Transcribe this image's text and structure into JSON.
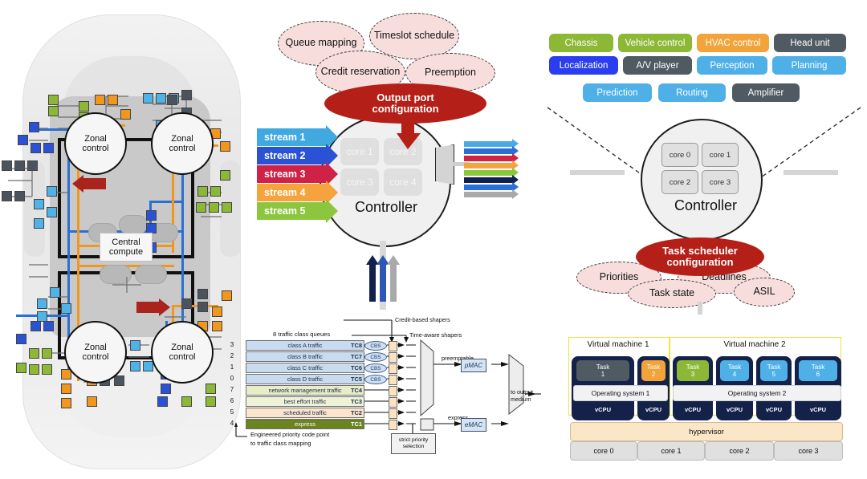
{
  "car_panel": {
    "zonal_controls": [
      {
        "id": "zonal-tl",
        "line1": "Zonal",
        "line2": "control"
      },
      {
        "id": "zonal-tr",
        "line1": "Zonal",
        "line2": "control"
      },
      {
        "id": "zonal-bl",
        "line1": "Zonal",
        "line2": "control"
      },
      {
        "id": "zonal-br",
        "line1": "Zonal",
        "line2": "control"
      }
    ],
    "central": {
      "line1": "Central",
      "line2": "compute"
    },
    "bus_colors": {
      "backbone": "#111111",
      "blue": "#2a6fd4",
      "orange": "#f0971f"
    },
    "ecu_colors": [
      "#7cb342",
      "#4a545e",
      "#f0971f",
      "#4fb3e8",
      "#2a52d4"
    ],
    "arrow_color": "#a8241c"
  },
  "mid_top": {
    "bubbles": [
      {
        "label": "Queue mapping"
      },
      {
        "label": "Timeslot schedule"
      },
      {
        "label": "Credit reservation"
      },
      {
        "label": "Preemption"
      }
    ],
    "config_ellipse": {
      "line1": "Output port",
      "line2": "configuration",
      "color": "#b41f18"
    },
    "streams": [
      {
        "label": "stream 1",
        "color": "#3fa9e0"
      },
      {
        "label": "stream 2",
        "color": "#2a52d4"
      },
      {
        "label": "stream 3",
        "color": "#cf2246"
      },
      {
        "label": "stream 4",
        "color": "#f5a33c"
      },
      {
        "label": "stream 5",
        "color": "#8cc63f"
      }
    ],
    "controller": {
      "label": "Controller",
      "cores": [
        "core 1",
        "core 2",
        "core 3",
        "core 4"
      ]
    },
    "output_arrow_colors": [
      "#4aabe3",
      "#2a6fd4",
      "#cf2246",
      "#f5a33c",
      "#8cc63f",
      "#11214b",
      "#2a6fd4",
      "#a9a9a9"
    ],
    "down_arrow_colors": [
      "#11214b",
      "#2f56b5",
      "#a9a9a9"
    ]
  },
  "right_top": {
    "chips_row1": [
      {
        "label": "Chassis",
        "color": "#8cb836"
      },
      {
        "label": "Vehicle control",
        "color": "#8cb836"
      },
      {
        "label": "HVAC control",
        "color": "#f2a33a"
      },
      {
        "label": "Head unit",
        "color": "#4f5a63"
      }
    ],
    "chips_row2": [
      {
        "label": "Localization",
        "color": "#2a3ef0"
      },
      {
        "label": "A/V player",
        "color": "#4f5a63"
      },
      {
        "label": "Perception",
        "color": "#4fb0e8"
      },
      {
        "label": "Planning",
        "color": "#4fb0e8"
      }
    ],
    "chips_row3": [
      {
        "label": "Prediction",
        "color": "#4fb0e8"
      },
      {
        "label": "Routing",
        "color": "#4fb0e8"
      },
      {
        "label": "Amplifier",
        "color": "#4f5a63"
      }
    ],
    "controller": {
      "label": "Controller",
      "cores": [
        "core 0",
        "core 1",
        "core 2",
        "core 3"
      ]
    },
    "config_ellipse": {
      "line1": "Task scheduler",
      "line2": "configuration",
      "color": "#b41f18"
    },
    "bubbles": [
      {
        "label": "Priorities"
      },
      {
        "label": "Deadlines"
      },
      {
        "label": "Task state"
      },
      {
        "label": "ASIL"
      }
    ]
  },
  "tsn": {
    "queues_title": "8 traffic class queues",
    "rows": [
      {
        "pcp": "3",
        "name": "class A traffic",
        "tc": "TC8",
        "fill": "#c9dcef",
        "text": "#21304a"
      },
      {
        "pcp": "2",
        "name": "class B traffic",
        "tc": "TC7",
        "fill": "#c9dcef",
        "text": "#21304a"
      },
      {
        "pcp": "1",
        "name": "class C traffic",
        "tc": "TC6",
        "fill": "#c9dcef",
        "text": "#21304a"
      },
      {
        "pcp": "0",
        "name": "class D traffic",
        "tc": "TC5",
        "fill": "#c9dcef",
        "text": "#21304a"
      },
      {
        "pcp": "7",
        "name": "network management traffic",
        "tc": "TC4",
        "fill": "#e7ecc9",
        "text": "#21304a"
      },
      {
        "pcp": "6",
        "name": "best effort traffic",
        "tc": "TC3",
        "fill": "#eef2d8",
        "text": "#21304a"
      },
      {
        "pcp": "5",
        "name": "scheduled traffic",
        "tc": "TC2",
        "fill": "#fbe6cd",
        "text": "#21304a"
      },
      {
        "pcp": "4",
        "name": "express",
        "tc": "TC1",
        "fill": "#6b8420",
        "text": "#ffffff"
      }
    ],
    "cbs_label": "CBS",
    "caption_mapping_l1": "Engineered priority code point",
    "caption_mapping_l2": "to traffic class mapping",
    "label_cbs_shapers": "Credit-based shapers",
    "label_tas_shapers": "Time-aware shapers",
    "label_strict_l1": "strict priority",
    "label_strict_l2": "selection",
    "label_preemptable": "preemptable",
    "label_express": "express",
    "pmac": "pMAC",
    "emac": "eMAC",
    "label_output_l1": "to output",
    "label_output_l2": "medium"
  },
  "vm": {
    "vm1_label": "Virtual machine 1",
    "vm2_label": "Virtual machine 2",
    "tasks": [
      {
        "label": "Task",
        "num": "1",
        "color": "#4f5a63"
      },
      {
        "label": "Task",
        "num": "2",
        "color": "#f2a33a"
      },
      {
        "label": "Task",
        "num": "3",
        "color": "#8cb836"
      },
      {
        "label": "Task",
        "num": "4",
        "color": "#4fb0e8"
      },
      {
        "label": "Task",
        "num": "5",
        "color": "#4fb0e8"
      },
      {
        "label": "Task",
        "num": "6",
        "color": "#4fb0e8"
      }
    ],
    "os1": "Operating system 1",
    "os2": "Operating system 2",
    "vcpu_label": "vCPU",
    "vcpu_count": 6,
    "hypervisor": "hypervisor",
    "cores": [
      "core 0",
      "core 1",
      "core 2",
      "core 3"
    ]
  }
}
